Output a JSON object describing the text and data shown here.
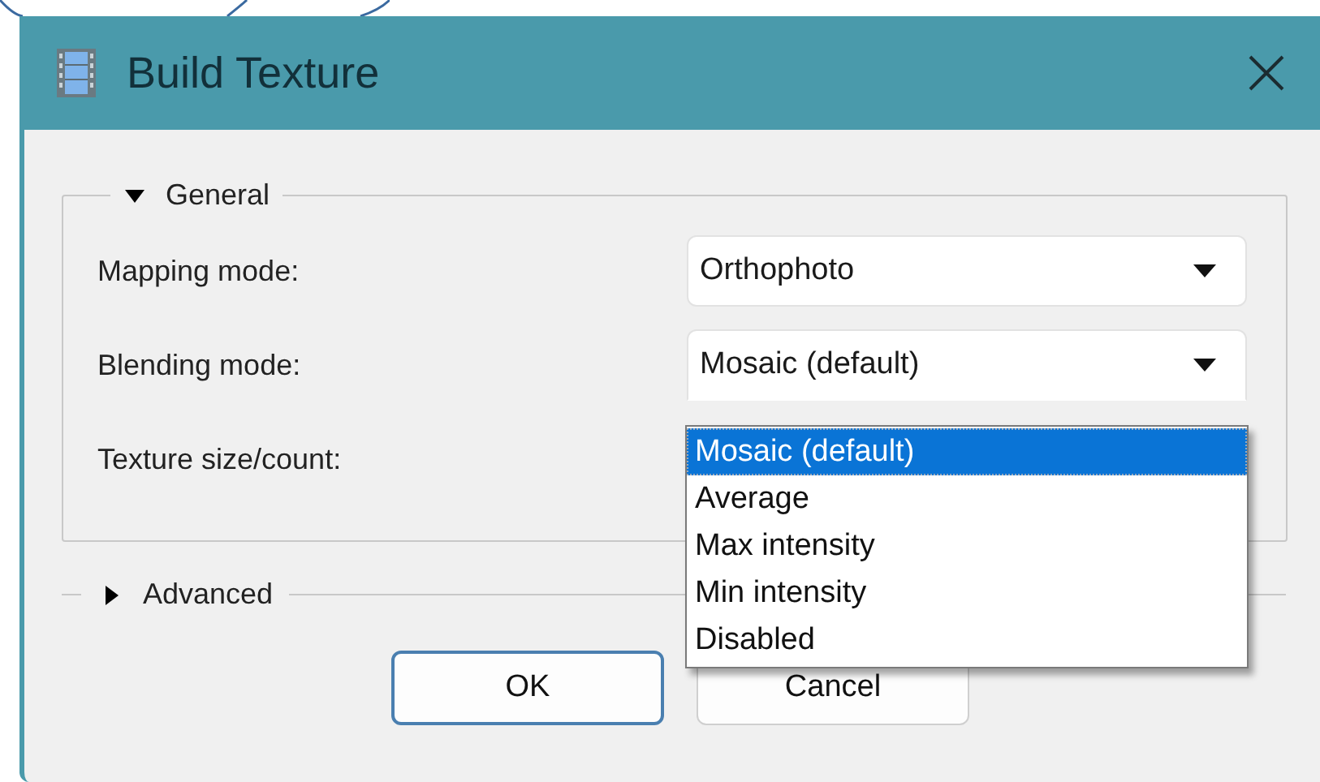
{
  "window": {
    "title": "Build Texture"
  },
  "general": {
    "label": "General",
    "expanded": true,
    "fields": [
      {
        "label": "Mapping mode:",
        "value": "Orthophoto"
      },
      {
        "label": "Blending mode:",
        "value": "Mosaic (default)"
      },
      {
        "label": "Texture size/count:"
      }
    ]
  },
  "dropdown": {
    "options": [
      {
        "label": "Mosaic (default)",
        "selected": true
      },
      {
        "label": "Average",
        "selected": false
      },
      {
        "label": "Max intensity",
        "selected": false
      },
      {
        "label": "Min intensity",
        "selected": false
      },
      {
        "label": "Disabled",
        "selected": false
      }
    ]
  },
  "advanced": {
    "label": "Advanced",
    "expanded": false
  },
  "buttons": [
    {
      "label": "OK",
      "default": true
    },
    {
      "label": "Cancel",
      "default": false
    }
  ]
}
